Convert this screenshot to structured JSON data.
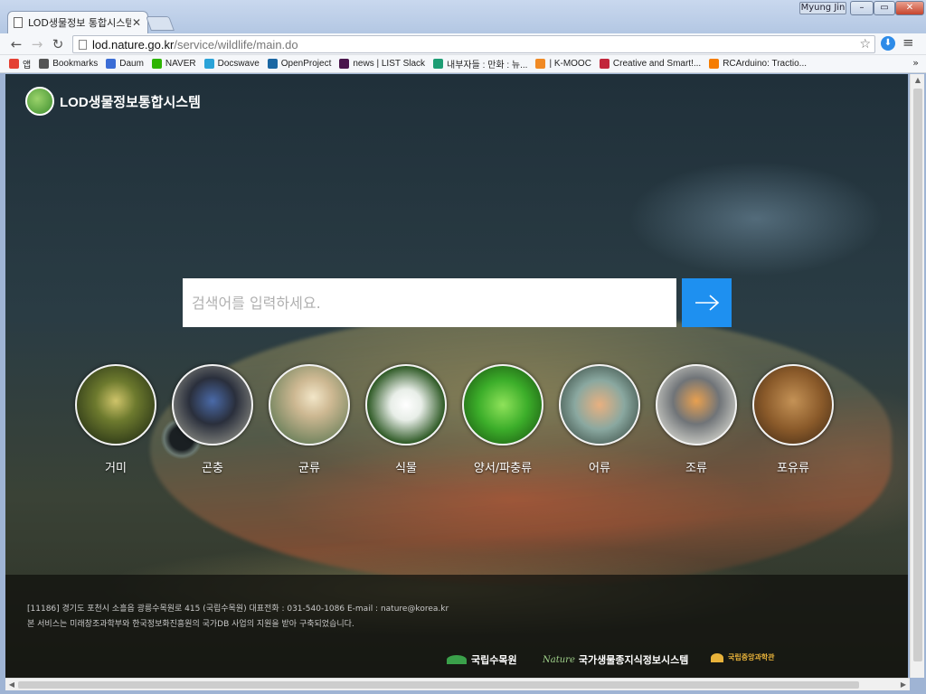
{
  "browser": {
    "tab_title": "LOD생물정보 통합시스템",
    "tab_close": "✕",
    "user_name": "Myung Jin",
    "url_host": "lod.nature.go.kr",
    "url_path": "/service/wildlife/main.do",
    "nav": {
      "back": "←",
      "forward": "→",
      "reload": "↻"
    },
    "star": "☆",
    "menu": "≡",
    "win_min": "–",
    "win_max": "▭",
    "win_close": "✕"
  },
  "bookmarks": [
    {
      "label": "앱",
      "icon": "apps-icon",
      "color": "#e44134"
    },
    {
      "label": "Bookmarks",
      "icon": "star-icon",
      "color": "#555555"
    },
    {
      "label": "Daum",
      "icon": "daum-icon",
      "color": "#3b6dd6"
    },
    {
      "label": "NAVER",
      "icon": "naver-icon",
      "color": "#2db400"
    },
    {
      "label": "Docswave",
      "icon": "docswave-icon",
      "color": "#2aa3d8"
    },
    {
      "label": "OpenProject",
      "icon": "openproject-icon",
      "color": "#1a67a3"
    },
    {
      "label": "news | LIST Slack",
      "icon": "slack-icon",
      "color": "#4a154b"
    },
    {
      "label": "내부자들 : 만화 : 뉴...",
      "icon": "comic-icon",
      "color": "#1d9d74"
    },
    {
      "label": "| K-MOOC",
      "icon": "kmooc-icon",
      "color": "#f08a24"
    },
    {
      "label": "Creative and Smart!...",
      "icon": "creative-icon",
      "color": "#c2263b"
    },
    {
      "label": "RCArduino: Tractio...",
      "icon": "blogger-icon",
      "color": "#f57d00"
    }
  ],
  "bookmarks_more": "»",
  "site": {
    "logo_text": "LOD생물정보통합시스템",
    "search_placeholder": "검색어를 입력하세요.",
    "accent_color": "#1e90f0"
  },
  "categories": [
    {
      "label": "거미",
      "icon": "spider-icon"
    },
    {
      "label": "곤충",
      "icon": "beetle-icon"
    },
    {
      "label": "균류",
      "icon": "mushroom-icon"
    },
    {
      "label": "식물",
      "icon": "flower-icon"
    },
    {
      "label": "양서/파충류",
      "icon": "frog-icon"
    },
    {
      "label": "어류",
      "icon": "fish-icon"
    },
    {
      "label": "조류",
      "icon": "bird-icon"
    },
    {
      "label": "포유류",
      "icon": "bear-icon"
    }
  ],
  "footer": {
    "address": "[11186] 경기도 포천시 소흘읍 광릉수목원로 415 (국립수목원) 대표전화 : 031-540-1086 E-mail : nature@korea.kr",
    "notice": "본 서비스는 미래창조과학부와 한국정보화진흥원의 국가DB 사업의 지원을 받아 구축되었습니다.",
    "logos": [
      "국립수목원",
      "국가생물종지식정보시스템",
      "국립중앙과학관"
    ],
    "nature_mark": "Nature"
  }
}
